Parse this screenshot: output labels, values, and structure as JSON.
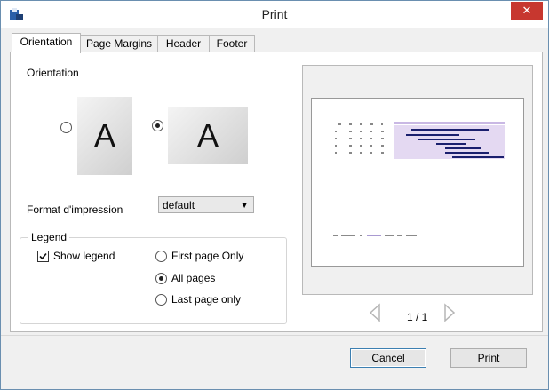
{
  "window": {
    "title": "Print",
    "close_glyph": "✕"
  },
  "tabs": [
    {
      "label": "Orientation",
      "active": true
    },
    {
      "label": "Page Margins",
      "active": false
    },
    {
      "label": "Header",
      "active": false
    },
    {
      "label": "Footer",
      "active": false
    }
  ],
  "orientation": {
    "heading": "Orientation",
    "portrait_letter": "A",
    "landscape_letter": "A",
    "selected": "landscape"
  },
  "format": {
    "label": "Format d'impression",
    "value": "default"
  },
  "legend": {
    "title": "Legend",
    "show_legend_label": "Show legend",
    "show_legend_checked": true,
    "options": [
      {
        "label": "First page Only",
        "checked": false
      },
      {
        "label": "All pages",
        "checked": true
      },
      {
        "label": "Last page only",
        "checked": false
      }
    ]
  },
  "preview": {
    "page_indicator": "1 / 1"
  },
  "buttons": {
    "cancel": "Cancel",
    "print": "Print"
  },
  "colors": {
    "accent": "#3c7fb1",
    "close": "#c7372f",
    "gantt_bar": "#1a1f6e",
    "gantt_band": "#e4d9f2"
  },
  "icons": {
    "app": "printer-app-icon",
    "prev": "triangle-left-icon",
    "next": "triangle-right-icon"
  }
}
